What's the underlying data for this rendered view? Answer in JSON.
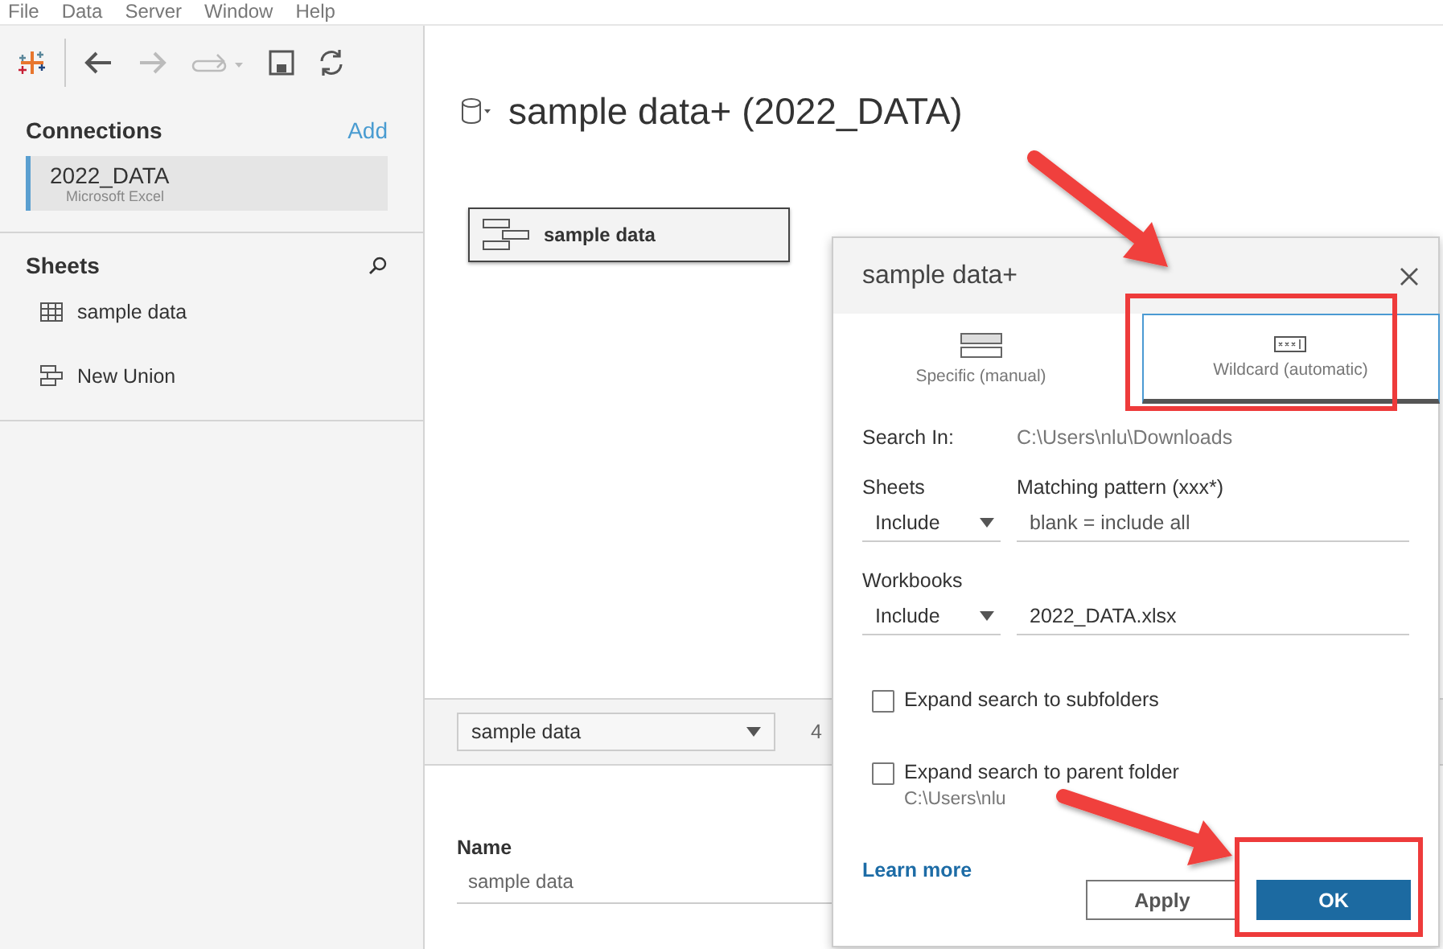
{
  "menu": [
    "File",
    "Data",
    "Server",
    "Window",
    "Help"
  ],
  "toolbar": [
    {
      "kind": "back",
      "disabled": false
    },
    {
      "kind": "forward",
      "disabled": true
    },
    {
      "kind": "redo",
      "disabled": true
    },
    {
      "kind": "save",
      "disabled": false
    },
    {
      "kind": "refresh",
      "disabled": false
    }
  ],
  "connections": {
    "title": "Connections",
    "add": "Add",
    "items": [
      {
        "name": "2022_DATA",
        "type": "Microsoft Excel",
        "selected": true
      }
    ]
  },
  "sheets": {
    "title": "Sheets",
    "items": [
      {
        "kind": "table",
        "label": "sample data"
      },
      {
        "kind": "union",
        "label": "New Union"
      }
    ]
  },
  "datasource_title": "sample data+ (2022_DATA)",
  "canvas_table": "sample data",
  "grid_bar": {
    "table_select": "sample data",
    "count": "4"
  },
  "details": {
    "name_label": "Name",
    "name_value": "sample data"
  },
  "dialog": {
    "title": "sample data+",
    "tabs": [
      {
        "kind": "specific",
        "label": "Specific (manual)",
        "selected": false
      },
      {
        "kind": "wildcard",
        "label": "Wildcard (automatic)",
        "selected": true
      }
    ],
    "search_in_label": "Search In:",
    "search_in_path": "C:\\Users\\nlu\\Downloads",
    "sheets": {
      "label": "Sheets",
      "mode": "Include",
      "pattern_label": "Matching pattern (xxx*)",
      "placeholder": "blank = include all"
    },
    "workbooks": {
      "label": "Workbooks",
      "mode": "Include",
      "value": "2022_DATA.xlsx"
    },
    "checkboxes": [
      {
        "label": "Expand search to subfolders",
        "checked": false
      },
      {
        "label": "Expand search to parent folder",
        "checked": false,
        "note": "C:\\Users\\nlu"
      }
    ],
    "learn_more": "Learn more",
    "apply": "Apply",
    "ok": "OK"
  }
}
